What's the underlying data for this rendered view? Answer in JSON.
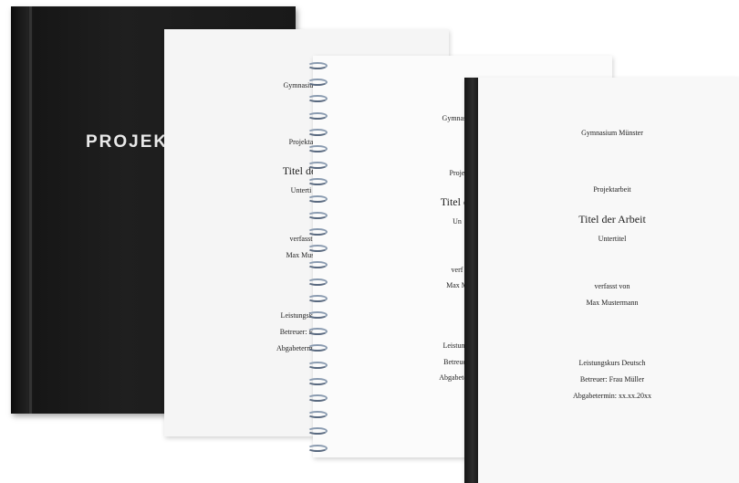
{
  "hardcover": {
    "title": "PROJEKT"
  },
  "softcover": {
    "school": "Gymnasium",
    "type": "Projekta",
    "title": "Titel der",
    "subtitle": "Unterti",
    "by": "verfasst",
    "author": "Max Must",
    "course": "Leistungskurs",
    "advisor": "Betreuer: Frau",
    "deadline": "Abgabetermin: x"
  },
  "spiral": {
    "school": "Gymnasiu",
    "type": "Proje",
    "title": "Titel de",
    "subtitle": "Un",
    "by": "verf",
    "author": "Max M",
    "course": "Leistungs",
    "advisor": "Betreuer:",
    "deadline": "Abgabeterm"
  },
  "binder": {
    "school": "Gymnasium Münster",
    "type": "Projektarbeit",
    "title": "Titel der Arbeit",
    "subtitle": "Untertitel",
    "by": "verfasst von",
    "author": "Max Mustermann",
    "course": "Leistungskurs Deutsch",
    "advisor": "Betreuer: Frau Müller",
    "deadline": "Abgabetermin: xx.xx.20xx"
  }
}
